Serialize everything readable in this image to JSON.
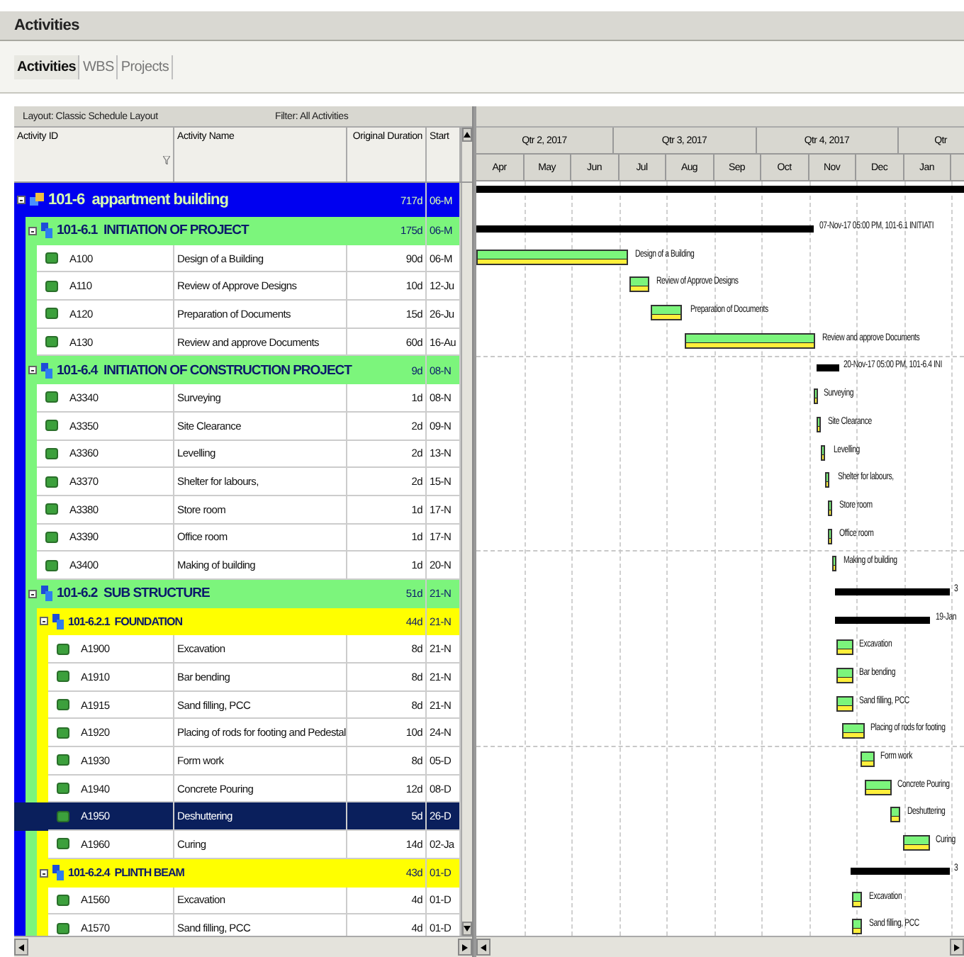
{
  "window": {
    "title": "Activities"
  },
  "tabs": [
    {
      "label": "Activities",
      "selected": true
    },
    {
      "label": "WBS",
      "selected": false
    },
    {
      "label": "Projects",
      "selected": false
    }
  ],
  "toolbar": {
    "layout": "Layout: Classic Schedule Layout",
    "filter": "Filter: All Activities"
  },
  "table": {
    "columns": [
      "Activity ID",
      "Activity Name",
      "Original Duration",
      "Start"
    ],
    "rows": [
      {
        "kind": "project",
        "id": "101-6",
        "name": "appartment building",
        "duration": "717d",
        "start": "06-M",
        "expanded": true,
        "children": [
          {
            "kind": "wbs",
            "id": "101-6.1",
            "name": "INITIATION OF PROJECT",
            "duration": "175d",
            "start": "06-M",
            "expanded": true,
            "bar_label": "07-Nov-17 05:00 PM, 101-6.1 INITIATI",
            "children": [
              {
                "kind": "activity",
                "id": "A100",
                "name": "Design of a Building",
                "duration": "90d",
                "start": "06-M",
                "selected": false,
                "bar_label": "Design of a Building"
              },
              {
                "kind": "activity",
                "id": "A110",
                "name": "Review of Approve Designs",
                "duration": "10d",
                "start": "12-Ju",
                "selected": false,
                "bar_label": "Review of Approve Designs"
              },
              {
                "kind": "activity",
                "id": "A120",
                "name": "Preparation of Documents",
                "duration": "15d",
                "start": "26-Ju",
                "selected": false,
                "bar_label": "Preparation of Documents"
              },
              {
                "kind": "activity",
                "id": "A130",
                "name": "Review and approve Documents",
                "duration": "60d",
                "start": "16-Au",
                "selected": false,
                "bar_label": "Review and approve Documents"
              }
            ]
          },
          {
            "kind": "wbs",
            "id": "101-6.4",
            "name": "INITIATION OF CONSTRUCTION PROJECT",
            "duration": "9d",
            "start": "08-N",
            "expanded": true,
            "bar_label": "20-Nov-17 05:00 PM, 101-6.4 INI",
            "children": [
              {
                "kind": "activity",
                "id": "A3340",
                "name": "Surveying",
                "duration": "1d",
                "start": "08-N",
                "selected": false,
                "bar_label": "Surveying"
              },
              {
                "kind": "activity",
                "id": "A3350",
                "name": "Site Clearance",
                "duration": "2d",
                "start": "09-N",
                "selected": false,
                "bar_label": "Site Clearance"
              },
              {
                "kind": "activity",
                "id": "A3360",
                "name": "Levelling",
                "duration": "2d",
                "start": "13-N",
                "selected": false,
                "bar_label": "Levelling"
              },
              {
                "kind": "activity",
                "id": "A3370",
                "name": "Shelter for labours,",
                "duration": "2d",
                "start": "15-N",
                "selected": false,
                "bar_label": "Shelter for labours,"
              },
              {
                "kind": "activity",
                "id": "A3380",
                "name": "Store room",
                "duration": "1d",
                "start": "17-N",
                "selected": false,
                "bar_label": "Store room"
              },
              {
                "kind": "activity",
                "id": "A3390",
                "name": "Office room",
                "duration": "1d",
                "start": "17-N",
                "selected": false,
                "bar_label": "Office room"
              },
              {
                "kind": "activity",
                "id": "A3400",
                "name": "Making of building",
                "duration": "1d",
                "start": "20-N",
                "selected": false,
                "bar_label": "Making of building"
              }
            ]
          },
          {
            "kind": "wbs",
            "id": "101-6.2",
            "name": "SUB STRUCTURE",
            "duration": "51d",
            "start": "21-N",
            "expanded": true,
            "bar_label": "3",
            "children": [
              {
                "kind": "wbs",
                "id": "101-6.2.1",
                "name": "FOUNDATION",
                "duration": "44d",
                "start": "21-N",
                "expanded": true,
                "bar_label": "19-Jan",
                "children": [
                  {
                    "kind": "activity",
                    "id": "A1900",
                    "name": "Excavation",
                    "duration": "8d",
                    "start": "21-N",
                    "selected": false,
                    "bar_label": "Excavation"
                  },
                  {
                    "kind": "activity",
                    "id": "A1910",
                    "name": "Bar bending",
                    "duration": "8d",
                    "start": "21-N",
                    "selected": false,
                    "bar_label": "Bar bending"
                  },
                  {
                    "kind": "activity",
                    "id": "A1915",
                    "name": "Sand filling, PCC",
                    "duration": "8d",
                    "start": "21-N",
                    "selected": false,
                    "bar_label": "Sand filling, PCC"
                  },
                  {
                    "kind": "activity",
                    "id": "A1920",
                    "name": "Placing of rods for footing and Pedestal",
                    "duration": "10d",
                    "start": "24-N",
                    "selected": false,
                    "bar_label": "Placing of rods for footing"
                  },
                  {
                    "kind": "activity",
                    "id": "A1930",
                    "name": "Form work",
                    "duration": "8d",
                    "start": "05-D",
                    "selected": false,
                    "bar_label": "Form work"
                  },
                  {
                    "kind": "activity",
                    "id": "A1940",
                    "name": "Concrete Pouring",
                    "duration": "12d",
                    "start": "08-D",
                    "selected": false,
                    "bar_label": "Concrete Pouring"
                  },
                  {
                    "kind": "activity",
                    "id": "A1950",
                    "name": "Deshuttering",
                    "duration": "5d",
                    "start": "26-D",
                    "selected": true,
                    "bar_label": "Deshuttering"
                  },
                  {
                    "kind": "activity",
                    "id": "A1960",
                    "name": "Curing",
                    "duration": "14d",
                    "start": "02-Ja",
                    "selected": false,
                    "bar_label": "Curing"
                  }
                ]
              },
              {
                "kind": "wbs",
                "id": "101-6.2.4",
                "name": "PLINTH BEAM",
                "duration": "43d",
                "start": "01-D",
                "expanded": true,
                "bar_label": "3",
                "children": [
                  {
                    "kind": "activity",
                    "id": "A1560",
                    "name": "Excavation",
                    "duration": "4d",
                    "start": "01-D",
                    "selected": false,
                    "bar_label": "Excavation"
                  },
                  {
                    "kind": "activity",
                    "id": "A1570",
                    "name": "Sand filling, PCC",
                    "duration": "4d",
                    "start": "01-D",
                    "selected": false,
                    "bar_label": "Sand filling, PCC"
                  }
                ]
              }
            ]
          }
        ]
      }
    ]
  },
  "gantt": {
    "quarters": [
      "Qtr 2, 2017",
      "Qtr 3, 2017",
      "Qtr 4, 2017",
      "Qtr"
    ],
    "months": [
      "Apr",
      "May",
      "Jun",
      "Jul",
      "Aug",
      "Sep",
      "Oct",
      "Nov",
      "Dec",
      "Jan"
    ]
  }
}
